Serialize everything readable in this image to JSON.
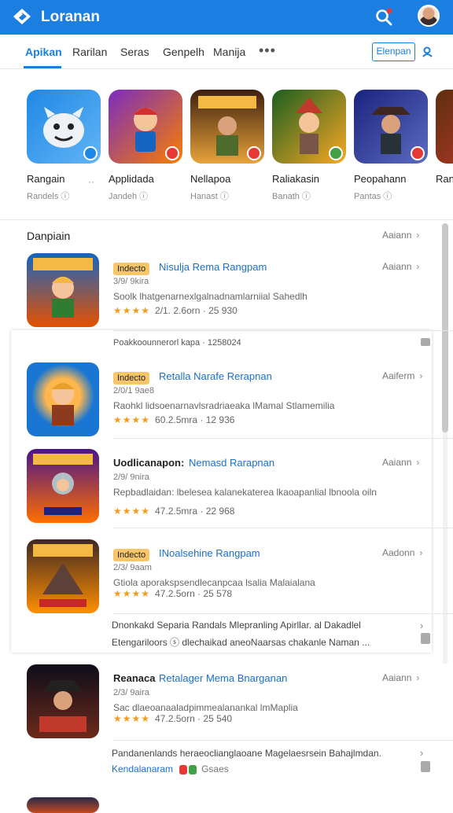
{
  "header": {
    "title": "Loranan",
    "icons": {
      "logo": "logo-icon",
      "search": "search-icon",
      "avatar": "avatar"
    }
  },
  "tabs": [
    "Apikan",
    "Rarilan",
    "Seras",
    "Genpelh",
    "Manija"
  ],
  "more_label": "•••",
  "filter_label": "Elenpan",
  "carousel": [
    {
      "name": "Rangain",
      "sub": "Randels ⓘ",
      "colors": [
        "#1e88e5",
        "#64b5f6"
      ],
      "badge": "#1e88e5"
    },
    {
      "name": "Applidada",
      "sub": "Jandeh ⓘ",
      "colors": [
        "#7b2cbf",
        "#f77f00"
      ],
      "badge": "#e53935"
    },
    {
      "name": "Nellapoa",
      "sub": "Hanast ⓘ",
      "colors": [
        "#3d1f0e",
        "#e8a33a"
      ],
      "badge": "#e53935"
    },
    {
      "name": "Raliakasin",
      "sub": "Banath ⓘ",
      "colors": [
        "#1b5e20",
        "#f9a825"
      ],
      "badge": "#43a047"
    },
    {
      "name": "Peopahann",
      "sub": "Pantas ⓘ",
      "colors": [
        "#1a237e",
        "#5c6bc0"
      ],
      "badge": "#e53935"
    },
    {
      "name": "Ran",
      "sub": "",
      "colors": [
        "#5d2e0e",
        "#c0392b"
      ],
      "badge": ""
    }
  ],
  "carousel_dots": "··",
  "section": {
    "title": "Danpiain",
    "more": "Aaiann",
    "chev": "›"
  },
  "rows": [
    {
      "tag": "Indecto",
      "title": "Nisulja Rema Rangpam",
      "meta": "3/9/ 9kira",
      "desc": "Soolk lhatgenarnexlgalnadnamlarniial Sahedlh",
      "rating": "2/1. 2.6orn · 25 930",
      "side": "Aaiann",
      "colors": [
        "#1565c0",
        "#e65100"
      ],
      "footer": "Poakkoounnerorl kapa · 1258024"
    },
    {
      "tag": "Indecto",
      "title": "Retalla Narafe Rerapnan",
      "meta": "2/0/1 9ae8",
      "desc": "Raohkl lidsoenarnavlsradriaeaka lMamal Stlamemilia",
      "rating": "60.2.5mra · 12 936",
      "side": "Aaiferm",
      "colors": [
        "#1976d2",
        "#ff9800"
      ]
    },
    {
      "tag": "",
      "lead": "Uodlicanapon:",
      "title": "Nemasd Rarapnan",
      "meta": "2/9/ 9nira",
      "desc": "Repbadlaidan: lbelesea kalanekaterea lkaoapanlial lbnoola oiln",
      "rating": "47.2.5mra · 22 968",
      "side": "Aaiann",
      "colors": [
        "#4a148c",
        "#ff6f00"
      ]
    },
    {
      "tag": "Indecto",
      "title": "INoalsehine Rangpam",
      "meta": "2/3/ 9aam",
      "desc": "Gtiola aporakspsendlecanpcaa lsalia Malaialana",
      "rating": "47.2.5orn · 25 578",
      "side": "Aadonn",
      "colors": [
        "#3e2723",
        "#ff8f00"
      ],
      "footer1": "Dnonkakd Separia Randals Mlepranling Apirllar. al Dakadlel",
      "footer2": "Etengariloors ⓢ dlechaikad aneoNaarsas chakanle Naman ..."
    },
    {
      "tag": "",
      "lead": "Reanaca",
      "title": "Retalager Mema Bnarganan",
      "meta": "2/3/ 9aira",
      "desc": "Sac dlaeoanaaladpimmealanankal lmMaplia",
      "rating": "47.2.5orn · 25 540",
      "side": "Aaiann",
      "colors": [
        "#0d0d1a",
        "#c0392b"
      ],
      "footer1": "Pandanenlands heraeoclianglaoane Magelaesrsein Bahajlmdan.",
      "footer2_blue": "Kendalanaram",
      "footer2": "Gsaes"
    }
  ]
}
